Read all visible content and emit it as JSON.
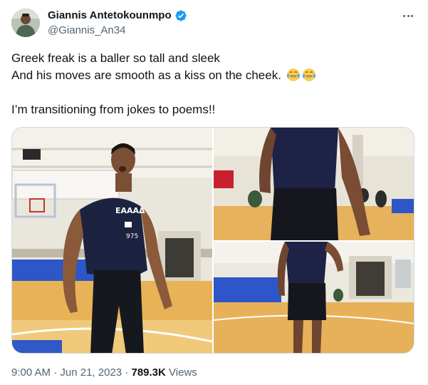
{
  "author": {
    "display_name": "Giannis Antetokounmpo",
    "handle": "@Giannis_An34",
    "verified": true,
    "verified_color": "#1d9bf0"
  },
  "tweet": {
    "lines": [
      "Greek freak is a baller so tall and sleek",
      "And his moves are smooth as a kiss on the cheek.",
      "I’m transitioning from jokes to poems!!"
    ],
    "emojis": [
      "face-with-tears-of-joy",
      "face-with-tears-of-joy"
    ]
  },
  "media": {
    "photos": [
      {
        "name": "player-jersey-photo",
        "jersey_text": "EAAAΔ"
      },
      {
        "name": "player-back-photo"
      },
      {
        "name": "player-walking-photo"
      }
    ]
  },
  "meta": {
    "time": "9:00 AM",
    "separator": "·",
    "date": "Jun 21, 2023",
    "views_count": "789.3K",
    "views_label": "Views"
  },
  "colors": {
    "text": "#0f1419",
    "secondary": "#536471",
    "border": "#cfd9de"
  }
}
